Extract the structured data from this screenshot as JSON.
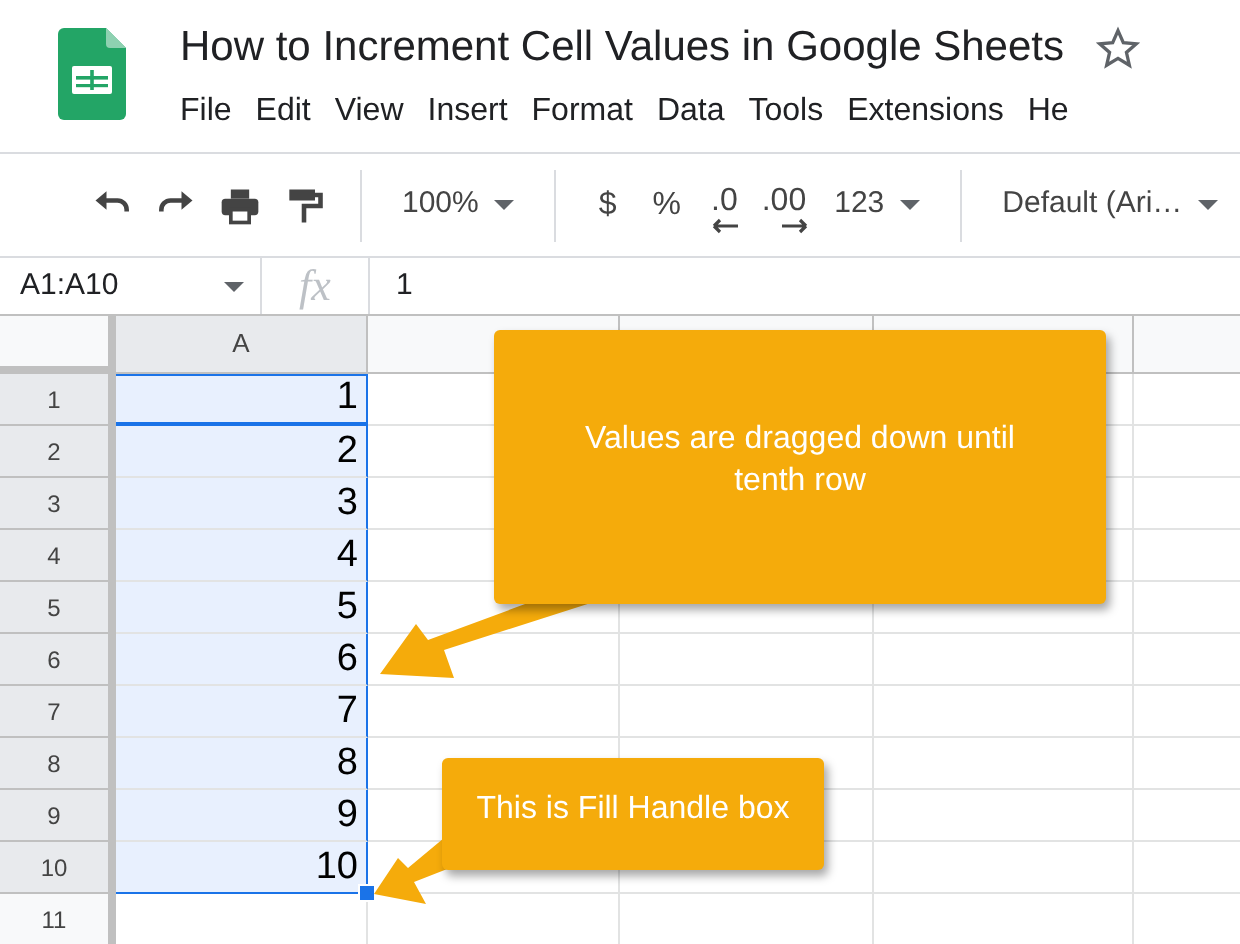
{
  "document": {
    "title": "How to Increment Cell Values in Google Sheets",
    "starred": false
  },
  "menu": [
    "File",
    "Edit",
    "View",
    "Insert",
    "Format",
    "Data",
    "Tools",
    "Extensions",
    "He"
  ],
  "toolbar": [
    {
      "kind": "undo"
    },
    {
      "kind": "redo"
    },
    {
      "kind": "print"
    },
    {
      "kind": "paint"
    },
    {
      "kind": "separator"
    },
    {
      "kind": "dropdown",
      "label": "100%"
    },
    {
      "kind": "separator"
    },
    {
      "kind": "text",
      "label": "$"
    },
    {
      "kind": "text",
      "label": "%"
    },
    {
      "kind": "decrease",
      "label": ".0"
    },
    {
      "kind": "increase",
      "label": ".00"
    },
    {
      "kind": "dropdown",
      "label": "123"
    },
    {
      "kind": "separator"
    },
    {
      "kind": "dropdown",
      "label": "Default (Ari…"
    }
  ],
  "formula_bar": {
    "name_box": "A1:A10",
    "function_label": "fx",
    "value": "1"
  },
  "grid": {
    "columns": [
      {
        "label": "A",
        "selected": true
      }
    ],
    "rows": [
      {
        "number": "1",
        "cells": [
          "1"
        ],
        "selected": true
      },
      {
        "number": "2",
        "cells": [
          "2"
        ],
        "selected": true
      },
      {
        "number": "3",
        "cells": [
          "3"
        ],
        "selected": true
      },
      {
        "number": "4",
        "cells": [
          "4"
        ],
        "selected": true
      },
      {
        "number": "5",
        "cells": [
          "5"
        ],
        "selected": true
      },
      {
        "number": "6",
        "cells": [
          "6"
        ],
        "selected": true
      },
      {
        "number": "7",
        "cells": [
          "7"
        ],
        "selected": true
      },
      {
        "number": "8",
        "cells": [
          "8"
        ],
        "selected": true
      },
      {
        "number": "9",
        "cells": [
          "9"
        ],
        "selected": true
      },
      {
        "number": "10",
        "cells": [
          "10"
        ],
        "selected": true
      },
      {
        "number": "11",
        "cells": [],
        "selected": false
      }
    ]
  },
  "callouts": [
    {
      "text": "Values are dragged down until tenth row"
    },
    {
      "text": "This is Fill Handle box"
    }
  ]
}
